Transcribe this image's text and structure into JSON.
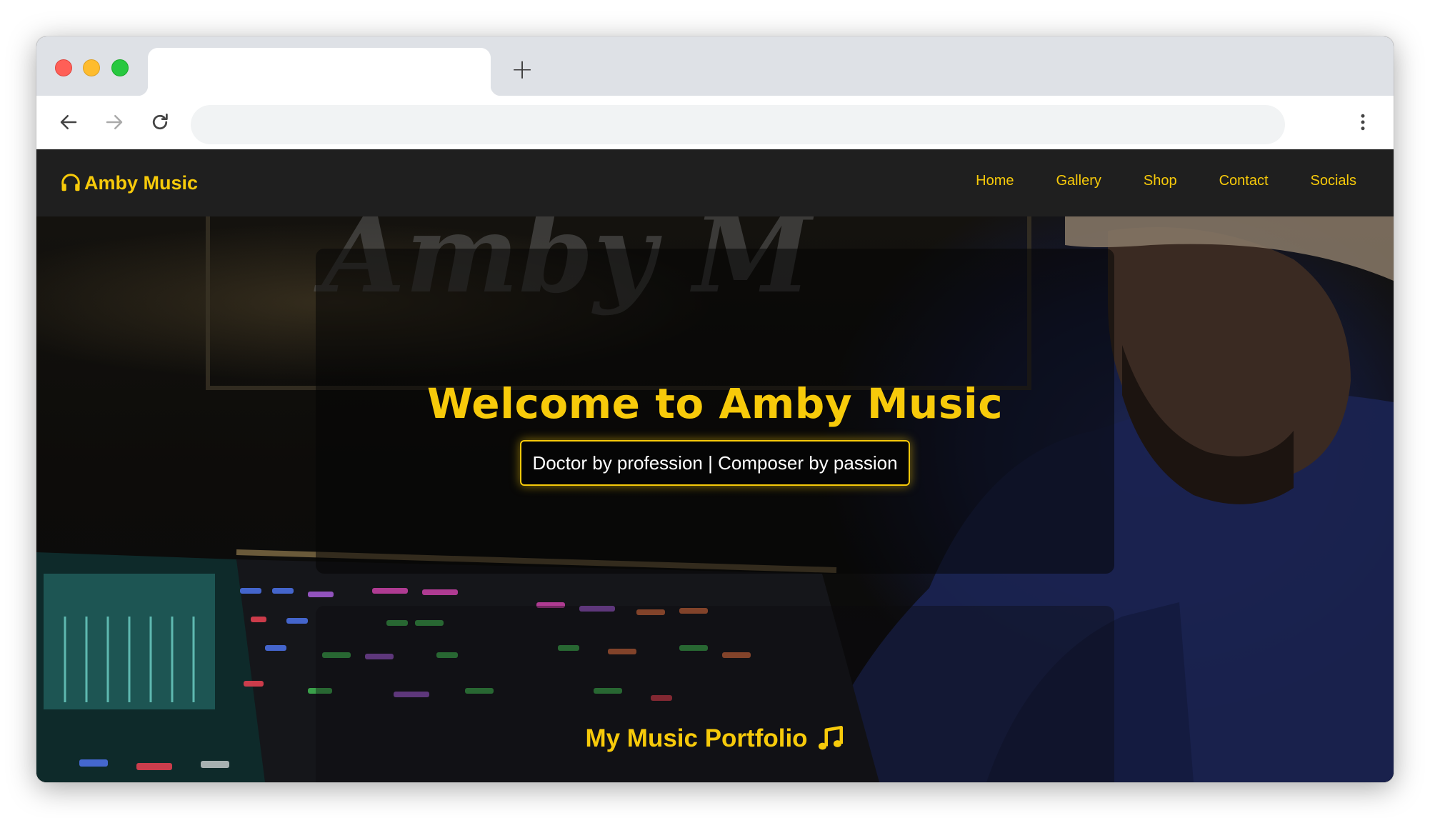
{
  "browser": {
    "tab_title": "",
    "new_tab_label": "+",
    "address": ""
  },
  "site": {
    "brand": "Amby Music",
    "brand_icon": "headphones-icon",
    "nav": [
      {
        "label": "Home"
      },
      {
        "label": "Gallery"
      },
      {
        "label": "Shop"
      },
      {
        "label": "Contact"
      },
      {
        "label": "Socials"
      }
    ]
  },
  "hero": {
    "title": "Welcome to Amby Music",
    "tagline": "Doctor by profession | Composer by passion",
    "neon_sign": "Amby M"
  },
  "portfolio": {
    "title": "My Music Portfolio",
    "icon": "music-note-icon"
  },
  "colors": {
    "accent": "#f7ca0a",
    "navbar": "#1f1f1f",
    "tagline_bg": "#050505"
  }
}
